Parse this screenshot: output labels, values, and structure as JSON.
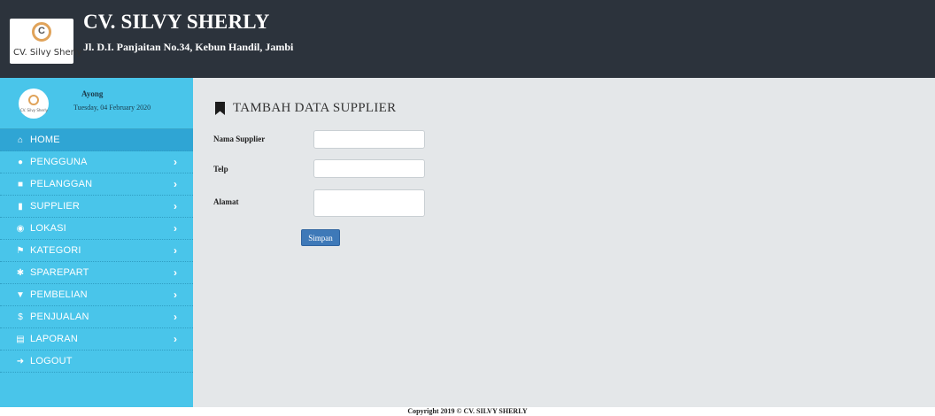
{
  "header": {
    "logo_text": "CV. Silvy Sherly",
    "logo_letter": "C",
    "title": "CV. SILVY SHERLY",
    "address": "Jl. D.I. Panjaitan No.34, Kebun Handil, Jambi"
  },
  "user": {
    "name": "Ayong",
    "date": "Tuesday, 04 February 2020",
    "avatar_text": "CV. Silvy Sherly"
  },
  "menu": [
    {
      "label": "HOME",
      "icon": "home-icon",
      "glyph": "⌂",
      "arrow": ""
    },
    {
      "label": "PENGGUNA",
      "icon": "user-icon",
      "glyph": "●",
      "arrow": "›"
    },
    {
      "label": "PELANGGAN",
      "icon": "briefcase-icon",
      "glyph": "■",
      "arrow": "›"
    },
    {
      "label": "SUPPLIER",
      "icon": "bookmark-icon",
      "glyph": "▮",
      "arrow": "›"
    },
    {
      "label": "LOKASI",
      "icon": "map-marker-icon",
      "glyph": "◉",
      "arrow": "›"
    },
    {
      "label": "KATEGORI",
      "icon": "flag-icon",
      "glyph": "⚑",
      "arrow": "›"
    },
    {
      "label": "SPAREPART",
      "icon": "cog-icon",
      "glyph": "✱",
      "arrow": "›"
    },
    {
      "label": "PEMBELIAN",
      "icon": "cart-icon",
      "glyph": "▼",
      "arrow": "›"
    },
    {
      "label": "PENJUALAN",
      "icon": "dollar-icon",
      "glyph": "$",
      "arrow": "›"
    },
    {
      "label": "LAPORAN",
      "icon": "file-icon",
      "glyph": "▤",
      "arrow": "›"
    },
    {
      "label": "LOGOUT",
      "icon": "logout-icon",
      "glyph": "➜",
      "arrow": ""
    }
  ],
  "page": {
    "title": "TAMBAH DATA SUPPLIER"
  },
  "form": {
    "nama_label": "Nama Supplier",
    "nama_value": "",
    "telp_label": "Telp",
    "telp_value": "",
    "alamat_label": "Alamat",
    "alamat_value": "",
    "submit_label": "Simpan"
  },
  "footer": {
    "copyright": "Copyright 2019 © CV. SILVY SHERLY"
  },
  "colors": {
    "header_bg": "#2c333c",
    "sidebar_bg": "#49c5ea",
    "main_bg": "#e4e7e9",
    "button_bg": "#3e79b8"
  }
}
